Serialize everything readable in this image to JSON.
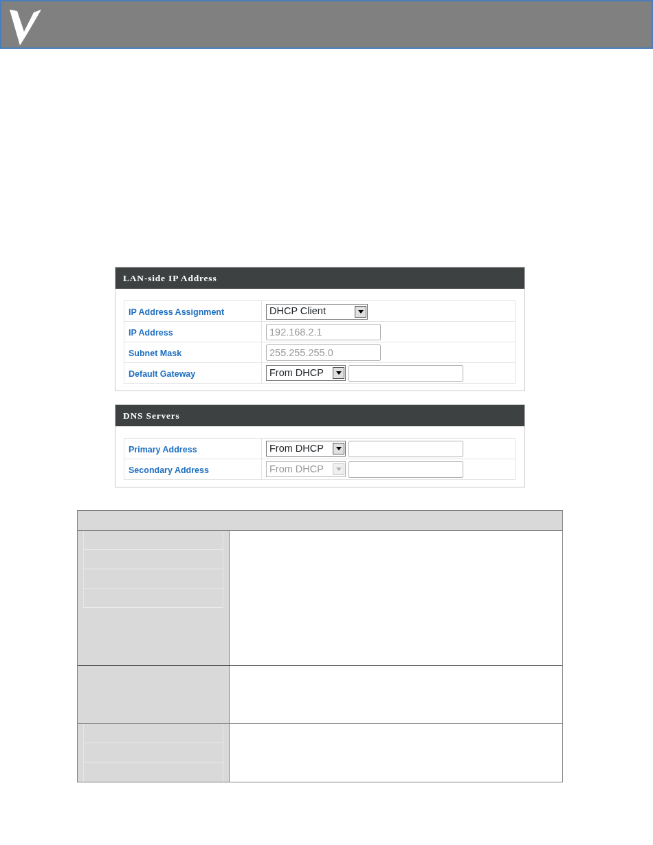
{
  "panels": [
    {
      "title": "LAN-side IP Address",
      "rows": [
        {
          "label": "IP Address Assignment",
          "kind": "select",
          "value": "DHCP Client",
          "disabled": false
        },
        {
          "label": "IP Address",
          "kind": "input",
          "value": "192.168.2.1",
          "disabled": true
        },
        {
          "label": "Subnet Mask",
          "kind": "input",
          "value": "255.255.255.0",
          "disabled": true
        },
        {
          "label": "Default Gateway",
          "kind": "select_input",
          "value": "From DHCP",
          "disabled": false
        }
      ]
    },
    {
      "title": "DNS Servers",
      "rows": [
        {
          "label": "Primary Address",
          "kind": "select_input",
          "value": "From DHCP",
          "disabled": false
        },
        {
          "label": "Secondary Address",
          "kind": "select_input",
          "value": "From DHCP",
          "disabled": true
        }
      ]
    }
  ]
}
